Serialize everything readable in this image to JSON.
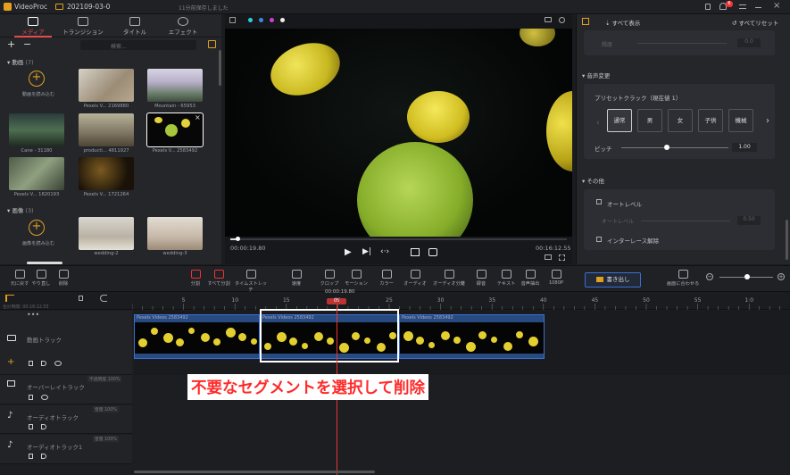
{
  "app": {
    "name": "VideoProc",
    "project": "202109-03-0",
    "save_status": "11分前保存しました",
    "notifications": "6"
  },
  "media_tabs": [
    {
      "label": "メディア"
    },
    {
      "label": "トランジション"
    },
    {
      "label": "タイトル"
    },
    {
      "label": "エフェクト"
    }
  ],
  "media": {
    "search_placeholder": "検索...",
    "video_section": "動画",
    "video_count": "(7)",
    "add_video": "動画を読み込む",
    "videos": [
      "Pexels V... 2169880",
      "Mountain - 65953",
      "Cane - 31180",
      "producti... 4811927",
      "Pexels V... 2583492",
      "Pexels V... 1820193",
      "Pexels V... 1721264"
    ],
    "image_section": "画像",
    "image_count": "(3)",
    "add_image": "画像を読み込む",
    "images": [
      "wedding-2",
      "wedding-3"
    ]
  },
  "preview": {
    "current_time": "00:00:19.80",
    "total_time": "00:16:12.55",
    "progress": 0.02
  },
  "right_panel": {
    "show_all": "すべて表示",
    "reset_all": "すべてリセット",
    "blur_label": "輝度",
    "blur_value": "0.0",
    "voice_section": "音声変更",
    "preset_label": "プリセットクラック（現在値 1）",
    "presets": [
      "通常",
      "男",
      "女",
      "子供",
      "機械"
    ],
    "pitch_label": "ピッチ",
    "pitch_value": "1.00",
    "other_section": "その他",
    "auto_level": "オートレベル",
    "auto_level_sub": "オートレベル",
    "auto_level_value": "0.50",
    "deinterlace": "インターレース解除"
  },
  "toolbar": {
    "tools": [
      "元に戻す",
      "やり直し",
      "削除",
      "分割",
      "すべて分割",
      "タイムストレッチ",
      "速度",
      "クロップ",
      "モーション",
      "カラー",
      "オーディオ",
      "オーディオ分離",
      "録音",
      "テキスト",
      "音声抽出",
      "1080P"
    ],
    "export_label": "書き出し",
    "fit_label": "画面に合わせる"
  },
  "timeline": {
    "playhead_time": "00:00:19.80",
    "marker": "05",
    "ruler": [
      "5",
      "10",
      "15",
      "20",
      "25",
      "30",
      "35",
      "40",
      "45",
      "50",
      "55",
      "1:0"
    ],
    "total_label": "合計時間: 00:16:12.55",
    "tracks": {
      "video": "動画トラック",
      "overlay": "オーバーレイトラック",
      "audio": "オーディオトラック",
      "audio1": "オーディオトラック1"
    },
    "clip_label": "Pexels Videos 2583492",
    "overlay_badge": "不透明度 100%",
    "audio_badge": "音量 100%",
    "annotation": "不要なセグメントを選択して削除"
  },
  "colors": {
    "accent": "#e64b4b",
    "export": "#3a6fd0",
    "annotation_text": "#ff2a2a",
    "playhead": "#e33"
  }
}
